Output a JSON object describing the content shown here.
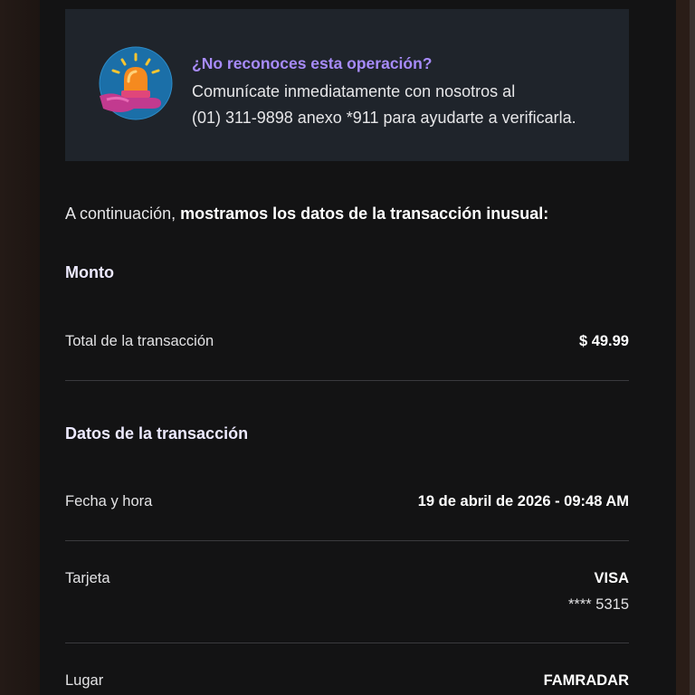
{
  "alert": {
    "title": "¿No reconoces esta operación?",
    "body_line1": "Comunícate inmediatamente con nosotros al",
    "body_line2": "(01) 311-9898 anexo *911 para ayudarte a verificarla.",
    "icon": "siren-icon"
  },
  "intro": {
    "prefix": "A continuación, ",
    "bold": "mostramos los datos de la transacción inusual:"
  },
  "monto": {
    "title": "Monto",
    "total_label": "Total de la transacción",
    "total_value": "$ 49.99"
  },
  "datos": {
    "title": "Datos de la transacción",
    "fecha_label": "Fecha y hora",
    "fecha_value": "19 de abril de 2026 - 09:48 AM",
    "tarjeta_label": "Tarjeta",
    "tarjeta_value": "VISA",
    "tarjeta_number": "**** 5315",
    "lugar_label": "Lugar",
    "lugar_value": "FAMRADAR"
  },
  "colors": {
    "accent": "#a78bfa",
    "background": "#131314",
    "alert_background": "#1f242b"
  }
}
